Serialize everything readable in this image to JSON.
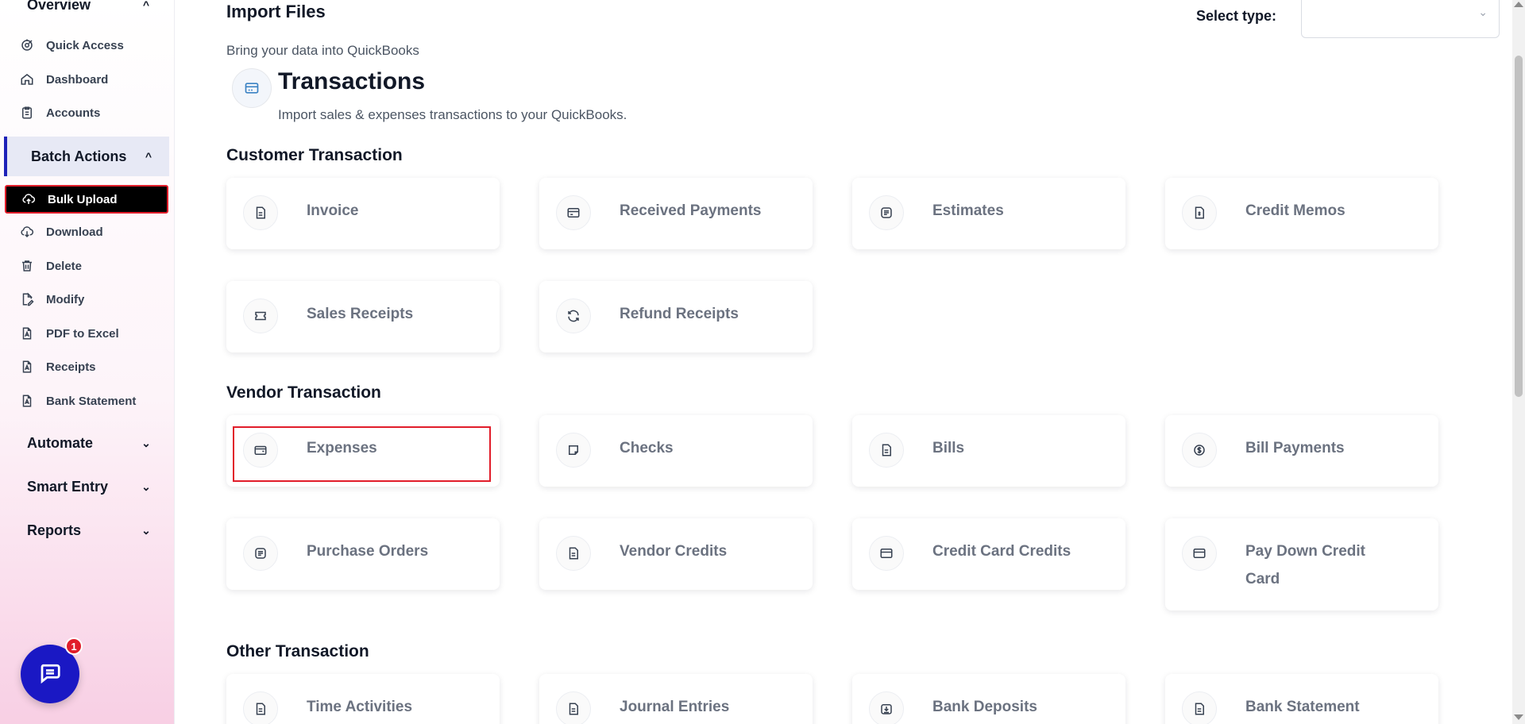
{
  "sidebar": {
    "overview": "Overview",
    "quick_access": "Quick Access",
    "dashboard": "Dashboard",
    "accounts": "Accounts",
    "batch_actions": "Batch Actions",
    "bulk_upload": "Bulk Upload",
    "download": "Download",
    "delete": "Delete",
    "modify": "Modify",
    "pdf_to_excel": "PDF to Excel",
    "receipts": "Receipts",
    "bank_statement": "Bank Statement",
    "automate": "Automate",
    "smart_entry": "Smart Entry",
    "reports": "Reports",
    "chat_badge": "1"
  },
  "header": {
    "title": "Import Files",
    "subtitle": "Bring your data into QuickBooks",
    "select_label": "Select type:",
    "select_value": ""
  },
  "transactions": {
    "title": "Transactions",
    "subtitle": "Import sales & expenses transactions to your QuickBooks."
  },
  "sections": {
    "customer": {
      "title": "Customer Transaction",
      "cards": [
        "Invoice",
        "Received Payments",
        "Estimates",
        "Credit Memos",
        "Sales Receipts",
        "Refund Receipts"
      ]
    },
    "vendor": {
      "title": "Vendor Transaction",
      "cards": [
        "Expenses",
        "Checks",
        "Bills",
        "Bill Payments",
        "Purchase Orders",
        "Vendor Credits",
        "Credit Card Credits",
        "Pay Down Credit Card"
      ]
    },
    "other": {
      "title": "Other Transaction",
      "cards": [
        "Time Activities",
        "Journal Entries",
        "Bank Deposits",
        "Bank Statement"
      ]
    }
  },
  "colors": {
    "accent": "#1a18c4",
    "highlight": "#e11d2a"
  }
}
